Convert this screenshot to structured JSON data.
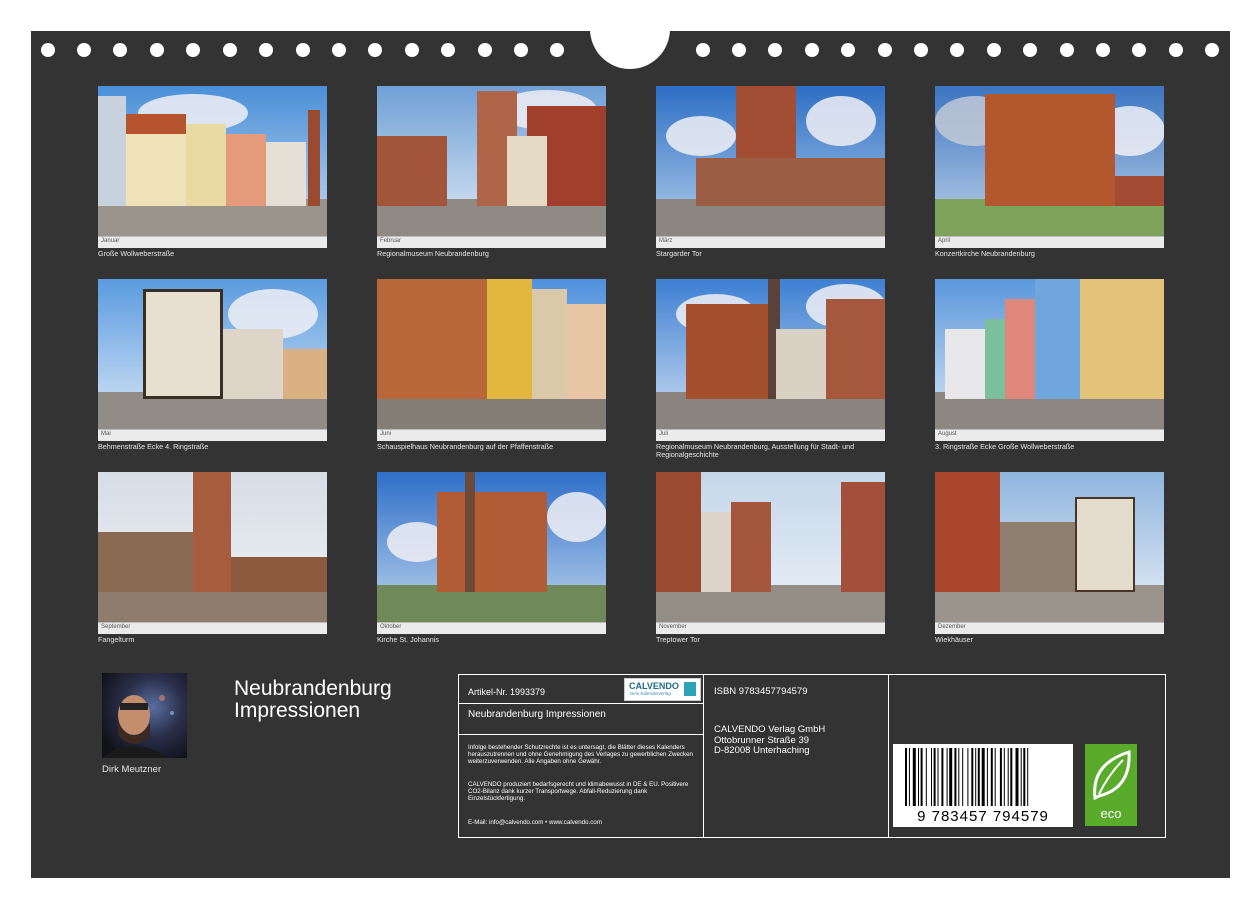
{
  "calendar": {
    "title_line1": "Neubrandenburg",
    "title_line2": "Impressionen",
    "author": "Dirk Meutzner"
  },
  "tiles": [
    {
      "caption": "Große Wollweberstraße",
      "month": "Januar"
    },
    {
      "caption": "Regionalmuseum Neubrandenburg",
      "month": "Februar"
    },
    {
      "caption": "Stargarder Tor",
      "month": "März"
    },
    {
      "caption": "Konzertkirche Neubrandenburg",
      "month": "April"
    },
    {
      "caption": "Behmenstraße Ecke 4. Ringstraße",
      "month": "Mai"
    },
    {
      "caption": "Schauspielhaus Neubrandenburg auf der Pfaffenstraße",
      "month": "Juni"
    },
    {
      "caption": "Regionalmuseum Neubrandenburg, Ausstellung für Stadt- und Regionalgeschichte",
      "month": "Juli"
    },
    {
      "caption": "3. Ringstraße Ecke Große Wollweberstraße",
      "month": "August"
    },
    {
      "caption": "Fangelturm",
      "month": "September"
    },
    {
      "caption": "Kirche St. Johannis",
      "month": "Oktober"
    },
    {
      "caption": "Treptower Tor",
      "month": "November"
    },
    {
      "caption": "Wiekhäuser",
      "month": "Dezember"
    }
  ],
  "info": {
    "article": "Artikel-Nr. 1993379",
    "product_title": "Neubrandenburg Impressionen",
    "calvendo_logo": "CALVENDO",
    "calvendo_tagline": "Dein Kalenderverlag",
    "legal1": "Infolge bestehender Schutzrechte ist es untersagt, die Blätter dieses Kalenders herauszutrennen und ohne Genehmigung des Verlages zu gewerblichen Zwecken weiterzuverwenden. Alle Angaben ohne Gewähr.",
    "legal2": "CALVENDO produziert bedarfsgerecht und klimabewusst in DE & EU. Positivere CO2-Bilanz dank kurzer Transportwege. Abfall-Reduzierung dank Einzelstückfertigung.",
    "contact": "E-Mail: info@calvendo.com • www.calvendo.com",
    "isbn": "ISBN 9783457794579",
    "publisher_name": "CALVENDO Verlag GmbH",
    "publisher_street": "Ottobrunner Straße 39",
    "publisher_city": "D-82008 Unterhaching",
    "barcode_digits": "9 783457 794579",
    "eco_label": "eco"
  },
  "colors": {
    "background": "#333333",
    "eco_green": "#5aaa2c"
  }
}
